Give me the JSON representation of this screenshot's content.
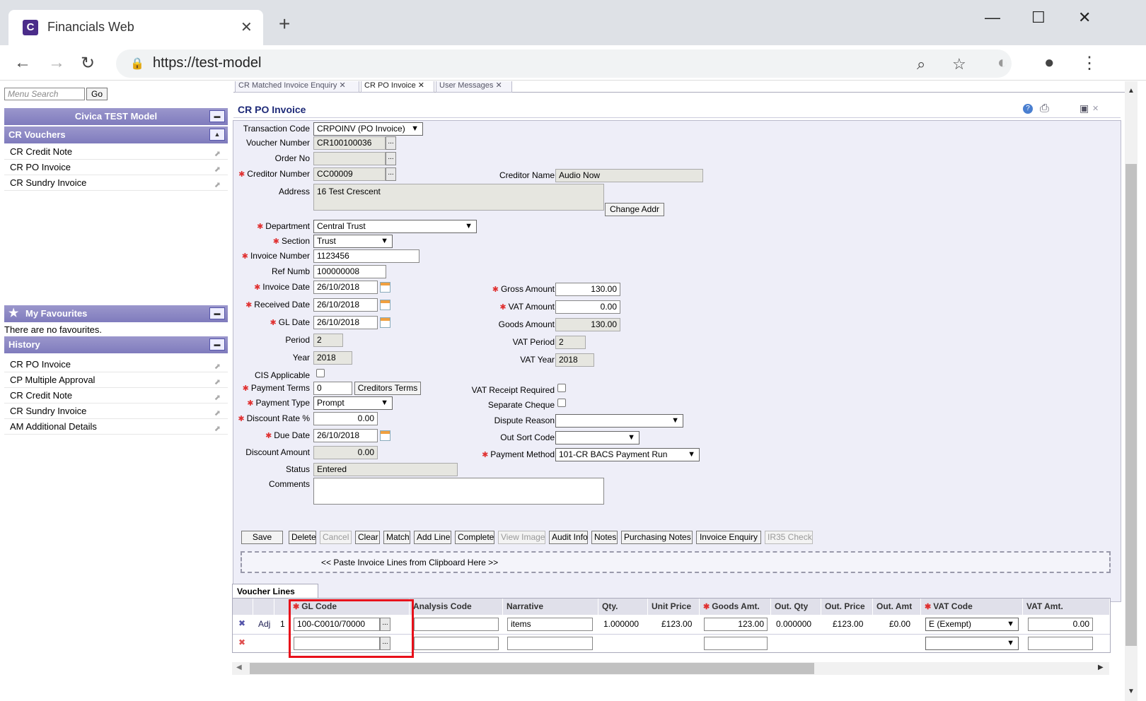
{
  "browser": {
    "tab_title": "Financials Web",
    "favicon_letter": "C",
    "url": "https://test-model",
    "new_tab": "+"
  },
  "left": {
    "menu_search_placeholder": "Menu Search",
    "go_label": "Go",
    "model_header": "Civica TEST Model",
    "vouchers_header": "CR Vouchers",
    "voucher_items": [
      "CR Credit Note",
      "CR PO Invoice",
      "CR Sundry Invoice"
    ],
    "favourites_header": "My Favourites",
    "favourites_empty": "There are no favourites.",
    "history_header": "History",
    "history_items": [
      "CR PO Invoice",
      "CP Multiple Approval",
      "CR Credit Note",
      "CR Sundry Invoice",
      "AM Additional Details"
    ]
  },
  "page_tabs": [
    "CR Matched Invoice Enquiry",
    "CR PO Invoice",
    "User Messages"
  ],
  "form": {
    "title": "CR PO Invoice",
    "labels": {
      "transaction_code": "Transaction Code",
      "voucher_number": "Voucher Number",
      "order_no": "Order No",
      "creditor_number": "Creditor Number",
      "creditor_name": "Creditor Name",
      "address": "Address",
      "change_addr": "Change Addr",
      "department": "Department",
      "section": "Section",
      "invoice_number": "Invoice Number",
      "ref_numb": "Ref Numb",
      "invoice_date": "Invoice Date",
      "received_date": "Received Date",
      "gl_date": "GL Date",
      "period": "Period",
      "year": "Year",
      "cis_applicable": "CIS Applicable",
      "payment_terms": "Payment Terms",
      "creditors_terms": "Creditors Terms",
      "payment_type": "Payment Type",
      "discount_rate": "Discount Rate %",
      "due_date": "Due Date",
      "discount_amount": "Discount Amount",
      "status": "Status",
      "comments": "Comments",
      "gross_amount": "Gross Amount",
      "vat_amount": "VAT Amount",
      "goods_amount": "Goods Amount",
      "vat_period": "VAT Period",
      "vat_year": "VAT Year",
      "vat_receipt_required": "VAT Receipt Required",
      "separate_cheque": "Separate Cheque",
      "dispute_reason": "Dispute Reason",
      "out_sort_code": "Out Sort Code",
      "payment_method": "Payment Method"
    },
    "values": {
      "transaction_code": "CRPOINV (PO Invoice)",
      "voucher_number": "CR100100036",
      "order_no": "",
      "creditor_number": "CC00009",
      "creditor_name": "Audio Now",
      "address": "16 Test Crescent",
      "department": "Central Trust",
      "section": "Trust",
      "invoice_number": "1123456",
      "ref_numb": "100000008",
      "invoice_date": "26/10/2018",
      "received_date": "26/10/2018",
      "gl_date": "26/10/2018",
      "period": "2",
      "year": "2018",
      "payment_terms": "0",
      "payment_type": "Prompt",
      "discount_rate": "0.00",
      "due_date": "26/10/2018",
      "discount_amount": "0.00",
      "status": "Entered",
      "gross_amount": "130.00",
      "vat_amount": "0.00",
      "goods_amount": "130.00",
      "vat_period": "2",
      "vat_year": "2018",
      "dispute_reason": "",
      "out_sort_code": "",
      "payment_method": "101-CR BACS Payment Run"
    }
  },
  "actions": [
    "Save",
    "Delete",
    "Cancel",
    "Clear",
    "Match",
    "Add Line",
    "Complete",
    "View Image",
    "Audit Info",
    "Notes",
    "Purchasing Notes",
    "Invoice Enquiry",
    "IR35 Check"
  ],
  "paste_text": "<< Paste Invoice Lines from Clipboard Here >>",
  "lines": {
    "tab_label": "Voucher Lines",
    "columns": [
      "GL Code",
      "Analysis Code",
      "Narrative",
      "Qty.",
      "Unit Price",
      "Goods Amt.",
      "Out. Qty",
      "Out. Price",
      "Out. Amt",
      "VAT Code",
      "VAT Amt."
    ],
    "row1": {
      "adj": "Adj",
      "line_no": "1",
      "gl_code": "100-C0010/70000",
      "analysis_code": "",
      "narrative": "items",
      "qty": "1.000000",
      "unit_price": "£123.00",
      "goods_amt": "123.00",
      "out_qty": "0.000000",
      "out_price": "£123.00",
      "out_amt": "£0.00",
      "vat_code": "E (Exempt)",
      "vat_amt": "0.00"
    }
  },
  "colors": {
    "header_purple": "#7f7bbd",
    "title_blue": "#1e2a78",
    "required_red": "#e03030",
    "highlight_red": "#e8101a"
  }
}
